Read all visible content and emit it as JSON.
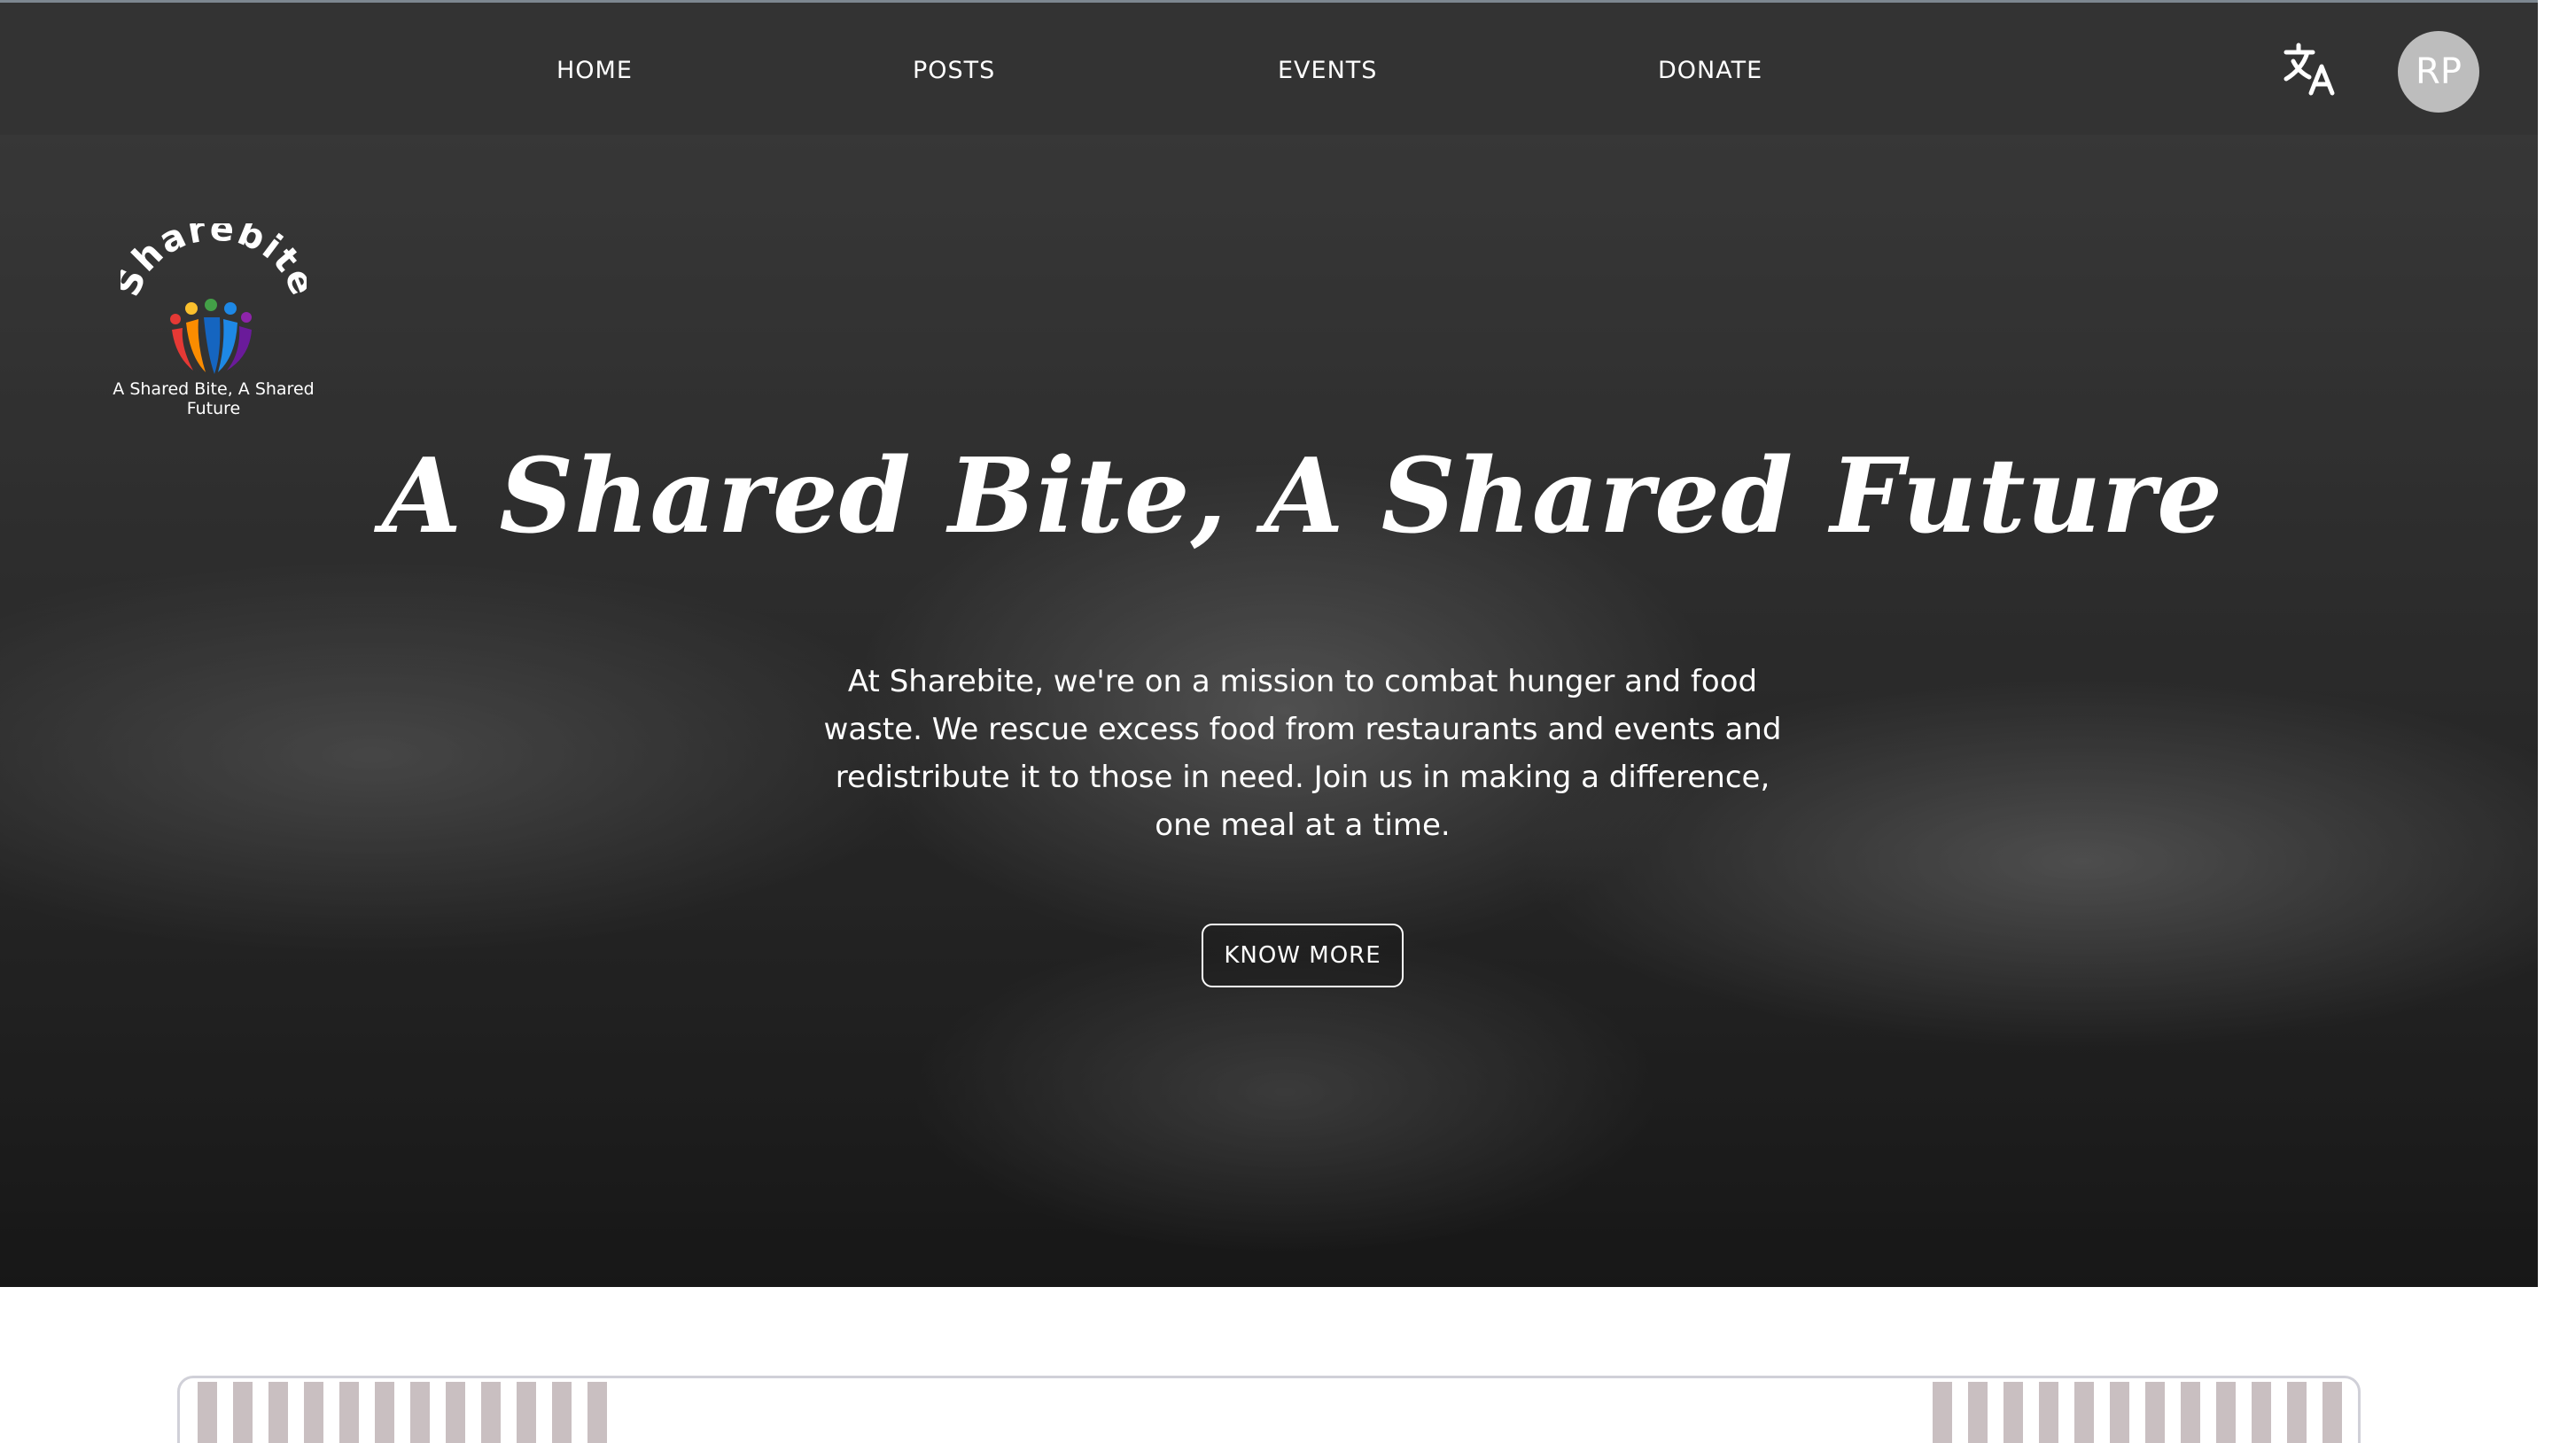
{
  "nav": {
    "items": [
      {
        "label": "HOME"
      },
      {
        "label": "POSTS"
      },
      {
        "label": "EVENTS"
      },
      {
        "label": "DONATE"
      }
    ],
    "translate_icon": "translate-icon",
    "avatar_initials": "RP"
  },
  "logo": {
    "name": "Sharebite",
    "tagline": "A Shared Bite, A Shared Future"
  },
  "hero": {
    "title": "A Shared Bite, A Shared Future",
    "description": "At Sharebite, we're on a mission to combat hunger and food waste. We rescue excess food from restaurants and events and redistribute it to those in need. Join us in making a difference, one meal at a time.",
    "button_label": "KNOW MORE"
  },
  "colors": {
    "topbar": "#333333",
    "avatar": "#bdbdbd",
    "stripe": "#c9bfc1"
  }
}
